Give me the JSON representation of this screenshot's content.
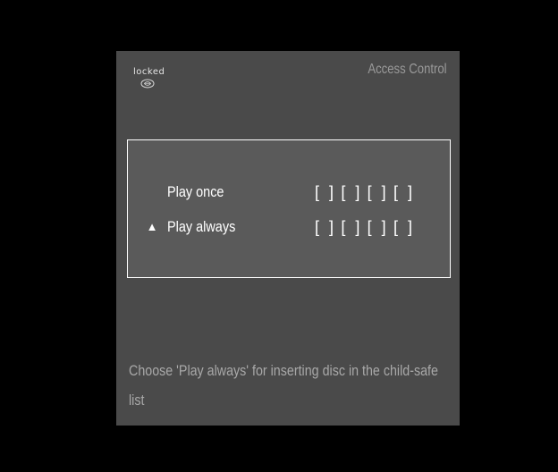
{
  "header": {
    "status": "locked",
    "status_icon": "disc-icon",
    "title": "Access Control"
  },
  "options": [
    {
      "marker": "",
      "label": "Play once",
      "slots": [
        "[ ]",
        "[ ]",
        "[ ]",
        "[ ]"
      ]
    },
    {
      "marker": "▲",
      "label": "Play always",
      "slots": [
        "[ ]",
        "[ ]",
        "[ ]",
        "[ ]"
      ]
    }
  ],
  "help": {
    "text": "Choose 'Play always' for inserting disc in the child-safe list"
  },
  "colors": {
    "background": "#000000",
    "panel": "#4a4a4a",
    "box": "#5a5a5a",
    "text_primary": "#ffffff",
    "text_secondary": "#a8a8a8"
  }
}
